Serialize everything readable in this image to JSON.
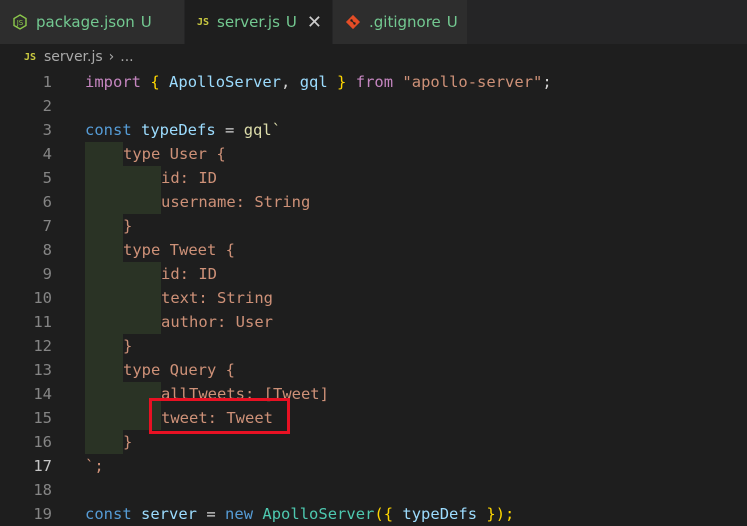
{
  "tabs": [
    {
      "label": "package.json",
      "status": "U",
      "icon": "nodejs-icon",
      "active": false
    },
    {
      "label": "server.js",
      "status": "U",
      "icon": "js-icon",
      "active": true,
      "close": "✕"
    },
    {
      "label": ".gitignore",
      "status": "U",
      "icon": "git-icon",
      "active": false
    }
  ],
  "breadcrumb": {
    "file": "server.js",
    "more": "..."
  },
  "editor": {
    "active_line": 17,
    "line_numbers": [
      "1",
      "2",
      "3",
      "4",
      "5",
      "6",
      "7",
      "8",
      "9",
      "10",
      "11",
      "12",
      "13",
      "14",
      "15",
      "16",
      "17",
      "18",
      "19"
    ],
    "lines": {
      "l1": [
        "import",
        "{",
        "ApolloServer",
        ",",
        "gql",
        "}",
        "from",
        "\"apollo-server\"",
        ";"
      ],
      "l3": [
        "const",
        "typeDefs",
        "=",
        "gql`"
      ],
      "l4": "type User {",
      "l5": "id: ID",
      "l6": "username: String",
      "l7": "}",
      "l8": "type Tweet {",
      "l9": "id: ID",
      "l10": "text: String",
      "l11": "author: User",
      "l12": "}",
      "l13": "type Query {",
      "l14": "allTweets: [Tweet]",
      "l15": "tweet: Tweet",
      "l16": "}",
      "l17": "`;",
      "l19": [
        "const",
        "server",
        "=",
        "new",
        "ApolloServer",
        "({",
        "typeDefs",
        "});"
      ]
    }
  },
  "colors": {
    "highlight_box": "#e81123",
    "accent_untracked": "#73c991"
  }
}
